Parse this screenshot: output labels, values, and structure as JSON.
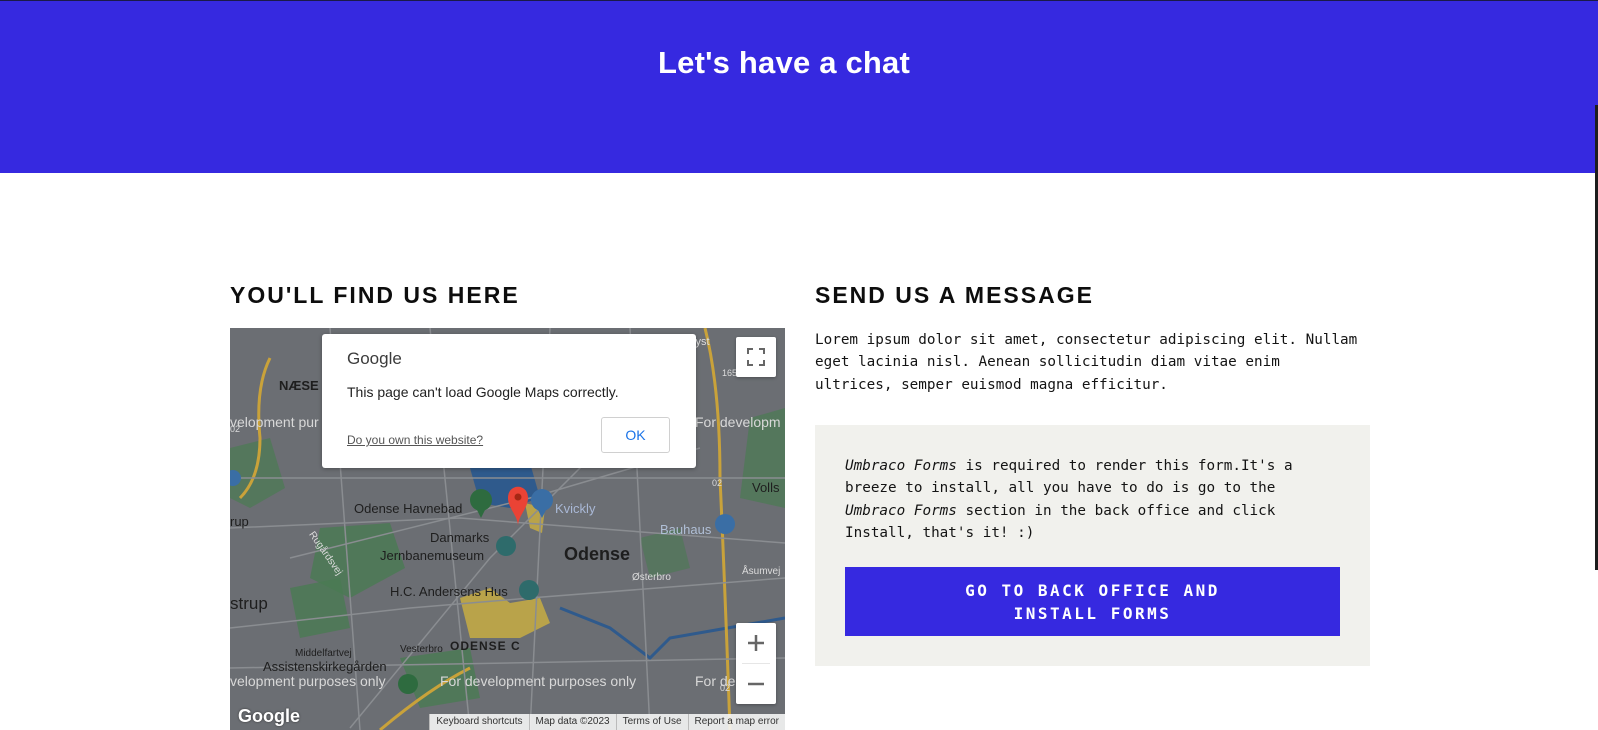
{
  "hero": {
    "title": "Let's have a chat"
  },
  "left": {
    "heading": "YOU'LL FIND US HERE",
    "map": {
      "dialog": {
        "brand": "Google",
        "message": "This page can't load Google Maps correctly.",
        "link": "Do you own this website?",
        "ok": "OK"
      },
      "labels": {
        "naese": "NÆSE",
        "havnebad": "Odense Havnebad",
        "kvickly": "Kvickly",
        "danmarks": "Danmarks",
        "jernbane": "Jernbanemuseum",
        "odense": "Odense",
        "bauhaus": "Bauhaus",
        "hca": "H.C. Andersens Hus",
        "odense_c": "ODENSE C",
        "middelfart": "Middelfartvej",
        "vesterbro": "Vesterbro",
        "assistens": "Assistenskirkegården",
        "vollsmose": "Volls",
        "strup": "strup",
        "rup": "rup",
        "osterbro": "Østerbro",
        "aasumvej": "Åsumvej",
        "rugardsvej": "Rugårdsvej",
        "nlyst": "nlyst",
        "road_165": "165",
        "road_02a": "02",
        "road_02b": "02",
        "road_02c": "02",
        "dev_1": "velopment pur",
        "dev_2": "For developm",
        "dev_3": "velopment purposes only",
        "dev_4": "For development purposes only",
        "dev_5": "For de"
      },
      "google_logo": "Google",
      "attribution": [
        "Keyboard shortcuts",
        "Map data ©2023",
        "Terms of Use",
        "Report a map error"
      ]
    }
  },
  "right": {
    "heading": "SEND US A MESSAGE",
    "intro": "Lorem ipsum dolor sit amet, consectetur adipiscing elit. Nullam eget lacinia nisl. Aenean sollicitudin diam vitae enim ultrices, semper euismod magna efficitur.",
    "form": {
      "product_1": "Umbraco Forms",
      "text_1": " is required to render this form.It's a breeze to install, all you have to do is go to the ",
      "product_2": "Umbraco Forms",
      "text_2": " section in the back office and click Install, that's it! :)",
      "button": "GO TO BACK OFFICE AND INSTALL FORMS"
    }
  },
  "colors": {
    "brand": "#3629e0",
    "form_bg": "#f1f1ed",
    "map_bg": "#6b6e73"
  }
}
